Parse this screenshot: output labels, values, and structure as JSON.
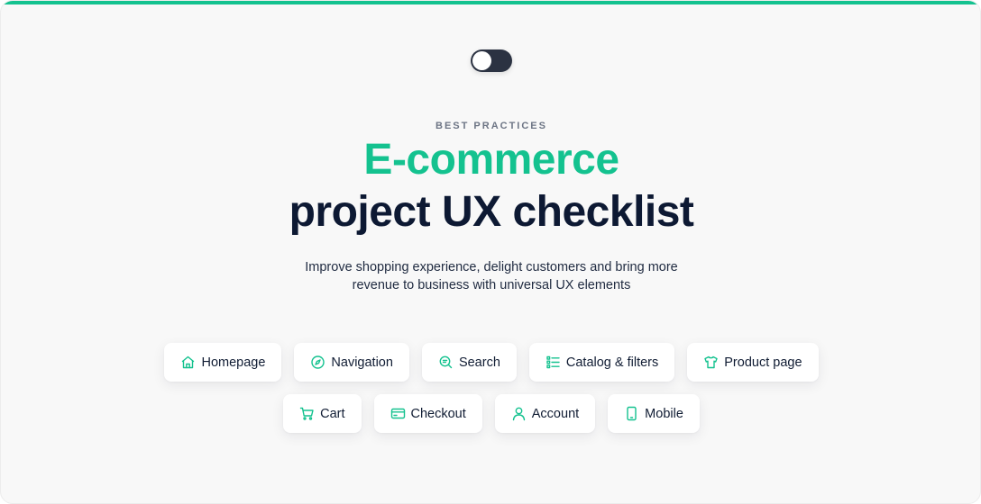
{
  "theme_toggle": {
    "state": "light",
    "accent": "#f2c94c"
  },
  "hero": {
    "eyebrow": "BEST PRACTICES",
    "title_accent": "E-commerce",
    "title_main": "project UX checklist",
    "subtitle": "Improve shopping experience, delight customers and bring more revenue to business with universal UX elements"
  },
  "categories": {
    "row1": [
      {
        "label": "Homepage",
        "icon": "home-icon"
      },
      {
        "label": "Navigation",
        "icon": "compass-icon"
      },
      {
        "label": "Search",
        "icon": "search-icon"
      },
      {
        "label": "Catalog & filters",
        "icon": "list-icon"
      },
      {
        "label": "Product page",
        "icon": "tshirt-icon"
      }
    ],
    "row2": [
      {
        "label": "Cart",
        "icon": "cart-icon"
      },
      {
        "label": "Checkout",
        "icon": "credit-card-icon"
      },
      {
        "label": "Account",
        "icon": "user-icon"
      },
      {
        "label": "Mobile",
        "icon": "mobile-icon"
      }
    ]
  },
  "colors": {
    "accent": "#14c28f",
    "heading": "#0d1933",
    "background": "#f8f8f8"
  }
}
